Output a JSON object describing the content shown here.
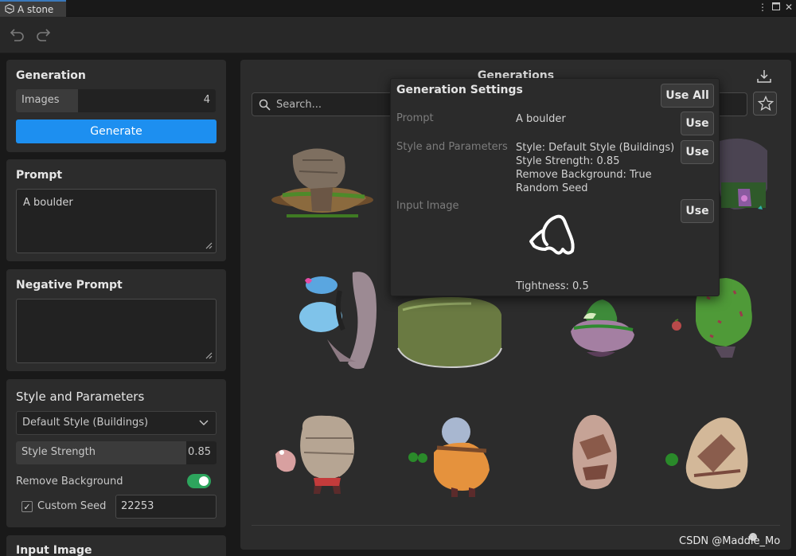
{
  "window": {
    "tab_title": "A stone",
    "controls": [
      "more-icon",
      "maximize-icon",
      "close-icon"
    ]
  },
  "toolbar": {
    "undo_icon": "undo-icon",
    "redo_icon": "redo-icon"
  },
  "generation": {
    "title": "Generation",
    "images_label": "Images",
    "images_value": "4",
    "images_fill_fraction": 0.31,
    "generate_label": "Generate"
  },
  "prompt": {
    "title": "Prompt",
    "value": "A boulder"
  },
  "negative_prompt": {
    "title": "Negative Prompt",
    "value": ""
  },
  "style": {
    "title": "Style and Parameters",
    "style_value": "Default Style (Buildings)",
    "strength_label": "Style Strength",
    "strength_value": "0.85",
    "strength_fraction": 0.85,
    "remove_bg_label": "Remove Background",
    "remove_bg_on": true,
    "custom_seed_label": "Custom Seed",
    "custom_seed_checked": true,
    "seed_value": "22253"
  },
  "input_image": {
    "title": "Input Image"
  },
  "generations": {
    "title": "Generations",
    "search_placeholder": "Search...",
    "download_icon": "download-icon",
    "star_icon": "star-icon"
  },
  "popup": {
    "title": "Generation Settings",
    "use_all": "Use All",
    "prompt_label": "Prompt",
    "prompt_value": "A boulder",
    "style_label": "Style and Parameters",
    "style_lines": [
      "Style: Default Style (Buildings)",
      "Style Strength: 0.85",
      "Remove Background: True",
      "Random Seed"
    ],
    "input_label": "Input Image",
    "tightness": "Tightness: 0.5",
    "use": "Use"
  },
  "watermark": "CSDN @Maddie_Mo",
  "colors": {
    "accent": "#1d8ff0",
    "toggle_on": "#2da55d",
    "panel": "#2c2c2c"
  }
}
